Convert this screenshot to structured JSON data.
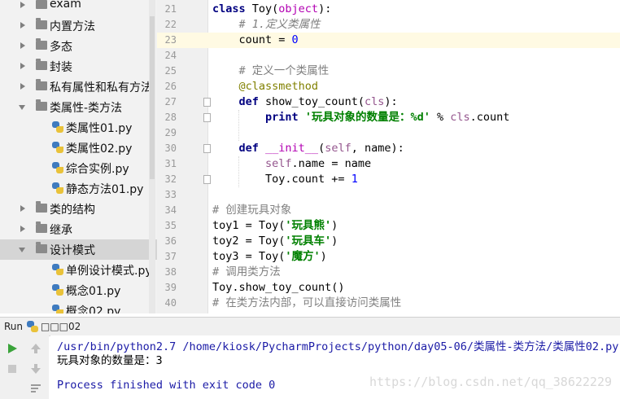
{
  "project_tree": {
    "items": [
      {
        "label": "exam",
        "type": "folder",
        "state": "collapsed",
        "indent": 0
      },
      {
        "label": "内置方法",
        "type": "folder",
        "state": "collapsed",
        "indent": 0
      },
      {
        "label": "多态",
        "type": "folder",
        "state": "collapsed",
        "indent": 0
      },
      {
        "label": "封装",
        "type": "folder",
        "state": "collapsed",
        "indent": 0
      },
      {
        "label": "私有属性和私有方法",
        "type": "folder",
        "state": "collapsed",
        "indent": 0
      },
      {
        "label": "类属性-类方法",
        "type": "folder",
        "state": "expanded",
        "indent": 0
      },
      {
        "label": "类属性01.py",
        "type": "py",
        "indent": 1
      },
      {
        "label": "类属性02.py",
        "type": "py",
        "indent": 1
      },
      {
        "label": "综合实例.py",
        "type": "py",
        "indent": 1
      },
      {
        "label": "静态方法01.py",
        "type": "py",
        "indent": 1
      },
      {
        "label": "类的结构",
        "type": "folder",
        "state": "collapsed",
        "indent": 0
      },
      {
        "label": "继承",
        "type": "folder",
        "state": "collapsed",
        "indent": 0
      },
      {
        "label": "设计模式",
        "type": "folder",
        "state": "expanded",
        "indent": 0,
        "selected": true
      },
      {
        "label": "单例设计模式.py",
        "type": "py",
        "indent": 1
      },
      {
        "label": "概念01.py",
        "type": "py",
        "indent": 1
      },
      {
        "label": "概念02.py",
        "type": "py",
        "indent": 1
      }
    ]
  },
  "editor": {
    "lines": [
      {
        "num": "21",
        "tokens": [
          {
            "c": "kw",
            "t": "class "
          },
          {
            "c": "",
            "t": "Toy("
          },
          {
            "c": "magic",
            "t": "object"
          },
          {
            "c": "",
            "t": "):"
          }
        ]
      },
      {
        "num": "22",
        "tokens": [
          {
            "c": "",
            "t": "    "
          },
          {
            "c": "cm",
            "t": "# 1.定义类属性"
          }
        ]
      },
      {
        "num": "23",
        "current": true,
        "tokens": [
          {
            "c": "",
            "t": "    count = "
          },
          {
            "c": "num",
            "t": "0"
          }
        ]
      },
      {
        "num": "24",
        "tokens": []
      },
      {
        "num": "25",
        "tokens": [
          {
            "c": "",
            "t": "    "
          },
          {
            "c": "cmz",
            "t": "# 定义一个类属性"
          }
        ]
      },
      {
        "num": "26",
        "tokens": [
          {
            "c": "",
            "t": "    "
          },
          {
            "c": "dec",
            "t": "@classmethod"
          }
        ]
      },
      {
        "num": "27",
        "fold": true,
        "tokens": [
          {
            "c": "",
            "t": "    "
          },
          {
            "c": "kw",
            "t": "def "
          },
          {
            "c": "",
            "t": "show_toy_count("
          },
          {
            "c": "self",
            "t": "cls"
          },
          {
            "c": "",
            "t": "):"
          }
        ]
      },
      {
        "num": "28",
        "fold": true,
        "tokens": [
          {
            "c": "",
            "t": "        "
          },
          {
            "c": "kw",
            "t": "print "
          },
          {
            "c": "str",
            "t": "'玩具对象的数量是：%d'"
          },
          {
            "c": "",
            "t": " % "
          },
          {
            "c": "self",
            "t": "cls"
          },
          {
            "c": "",
            "t": ".count"
          }
        ]
      },
      {
        "num": "29",
        "tokens": []
      },
      {
        "num": "30",
        "fold": true,
        "tokens": [
          {
            "c": "",
            "t": "    "
          },
          {
            "c": "kw",
            "t": "def "
          },
          {
            "c": "magic",
            "t": "__init__"
          },
          {
            "c": "",
            "t": "("
          },
          {
            "c": "self",
            "t": "self"
          },
          {
            "c": "",
            "t": ", name):"
          }
        ]
      },
      {
        "num": "31",
        "tokens": [
          {
            "c": "",
            "t": "        "
          },
          {
            "c": "self",
            "t": "self"
          },
          {
            "c": "",
            "t": ".name = name"
          }
        ]
      },
      {
        "num": "32",
        "fold": true,
        "tokens": [
          {
            "c": "",
            "t": "        Toy.count += "
          },
          {
            "c": "num",
            "t": "1"
          }
        ]
      },
      {
        "num": "33",
        "tokens": []
      },
      {
        "num": "34",
        "tokens": [
          {
            "c": "cmz",
            "t": "# 创建玩具对象"
          }
        ]
      },
      {
        "num": "35",
        "tokens": [
          {
            "c": "",
            "t": "toy1 = Toy("
          },
          {
            "c": "str",
            "t": "'玩具熊'"
          },
          {
            "c": "",
            "t": ")"
          }
        ]
      },
      {
        "num": "36",
        "tokens": [
          {
            "c": "",
            "t": "toy2 = Toy("
          },
          {
            "c": "str",
            "t": "'玩具车'"
          },
          {
            "c": "",
            "t": ")"
          }
        ]
      },
      {
        "num": "37",
        "tokens": [
          {
            "c": "",
            "t": "toy3 = Toy("
          },
          {
            "c": "str",
            "t": "'魔方'"
          },
          {
            "c": "",
            "t": ")"
          }
        ]
      },
      {
        "num": "38",
        "tokens": [
          {
            "c": "cmz",
            "t": "# 调用类方法"
          }
        ]
      },
      {
        "num": "39",
        "tokens": [
          {
            "c": "",
            "t": "Toy.show_toy_count()"
          }
        ]
      },
      {
        "num": "40",
        "tokens": [
          {
            "c": "cmz",
            "t": "# 在类方法内部，可以直接访问类属性"
          }
        ]
      }
    ]
  },
  "run_panel": {
    "title": "Run",
    "config_name": "□□□02",
    "console": {
      "command": "/usr/bin/python2.7 /home/kiosk/PycharmProjects/python/day05-06/类属性-类方法/类属性02.py",
      "output": "玩具对象的数量是：3",
      "exit_message": "Process finished with exit code 0"
    }
  },
  "watermark": "https://blog.csdn.net/qq_38622229",
  "icons": [
    "rerun-icon",
    "stop-icon",
    "scroll-up-icon",
    "scroll-down-icon",
    "soft-wrap-icon",
    "python-file-icon",
    "folder-icon"
  ]
}
